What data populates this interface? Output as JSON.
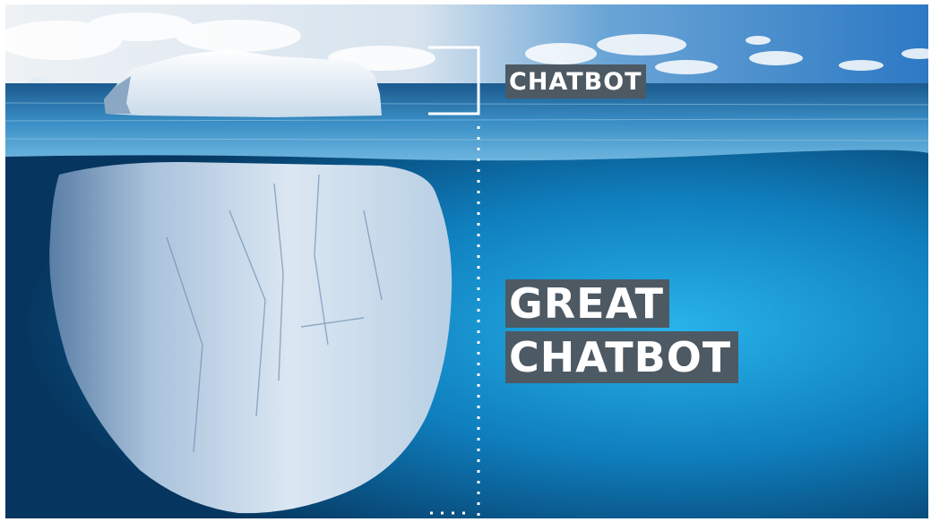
{
  "labels": {
    "top": "CHATBOT",
    "bottom_line_1": "GREAT",
    "bottom_line_2": "CHATBOT"
  },
  "colors": {
    "label_background": "#4d5963",
    "label_text": "#ffffff",
    "sky": "#4f8cc4",
    "sea_surface": "#2e7fb6",
    "deep_water": "#0a5f95",
    "ice": "#dde8f2"
  }
}
